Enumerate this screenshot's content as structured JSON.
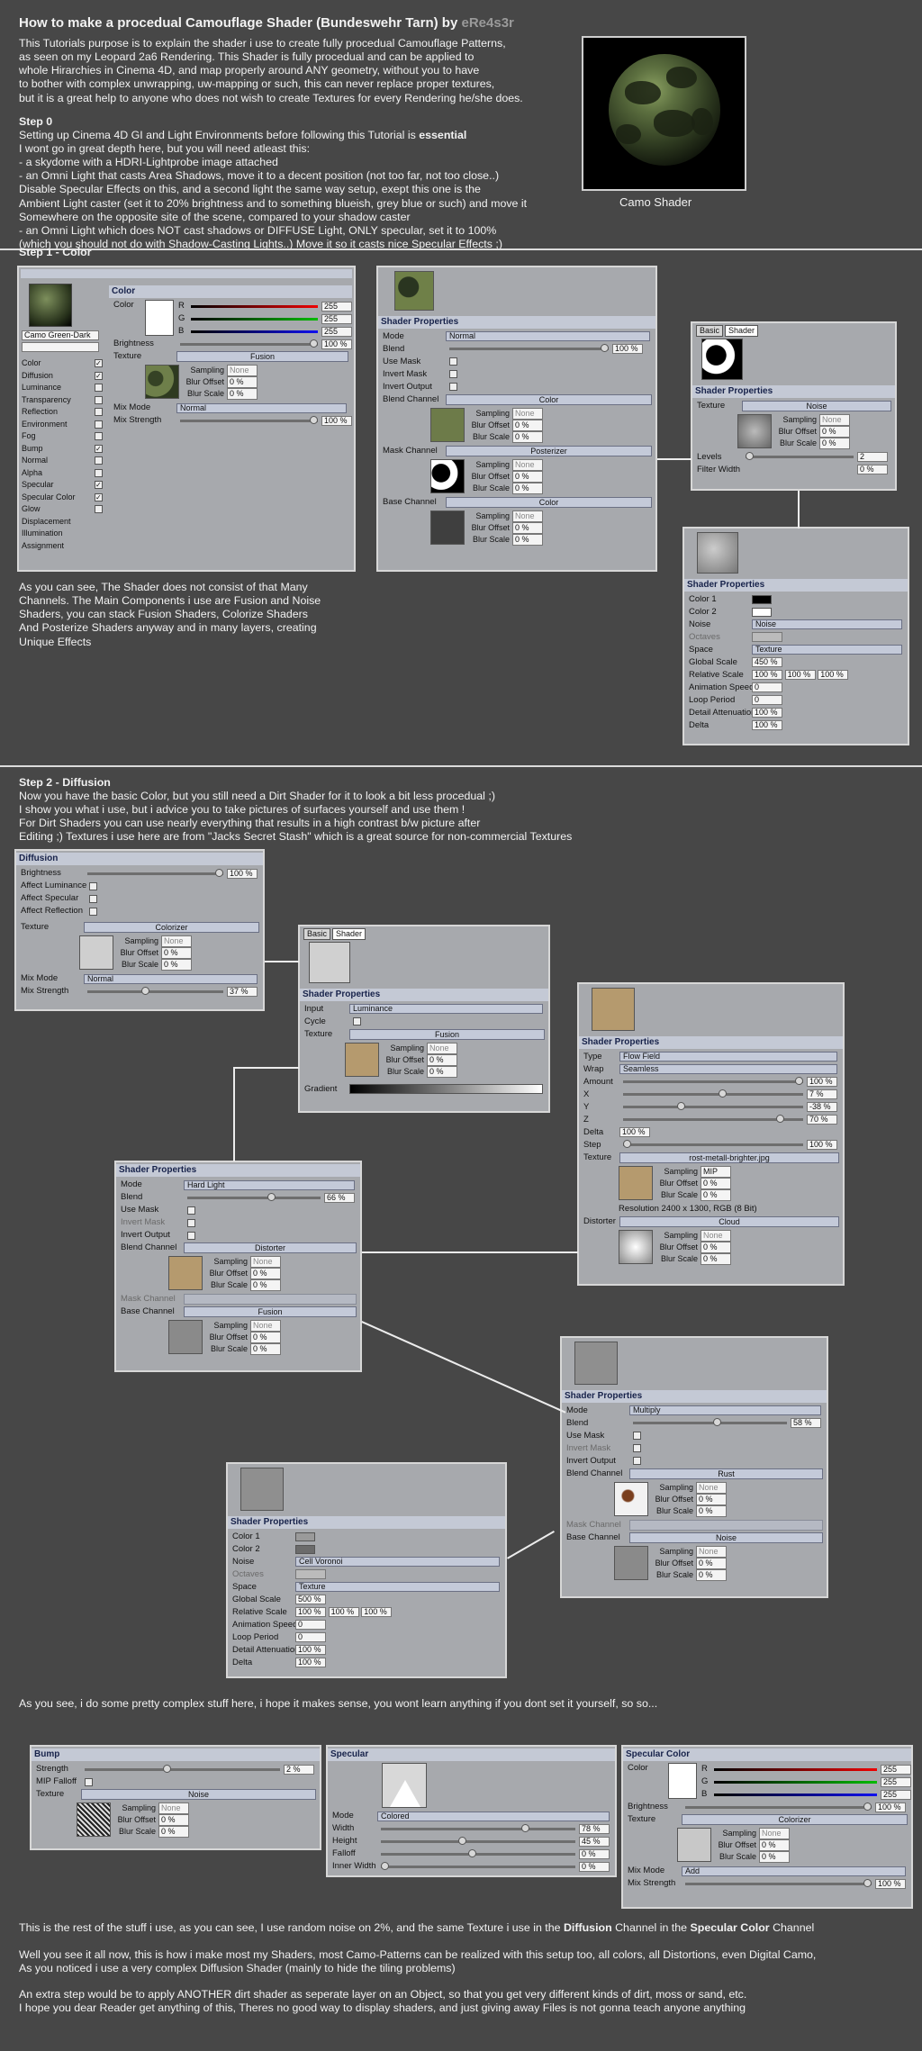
{
  "title": "How to make a procedual Camouflage Shader (Bundeswehr Tarn) by",
  "author": "eRe4s3r",
  "intro": "This Tutorials purpose is to explain the shader i use to create fully procedual Camouflage Patterns,\nas seen on my Leopard 2a6 Rendering. This Shader is fully procedual and can be applied to\nwhole Hirarchies in Cinema 4D, and map properly around ANY geometry, without you to have\nto bother with complex unwrapping, uw-mapping or such, this can never replace proper textures,\nbut it is a great help to anyone who does not wish to create Textures for every Rendering he/she does.",
  "preview_caption": "Camo Shader",
  "step0": {
    "heading": "Step 0",
    "line1": "Setting up Cinema 4D GI and Light Environments before following this Tutorial is",
    "line1_bold": "essential",
    "body": "I wont go in great depth here, but you will need atleast this:\n- a skydome with a HDRI-Lightprobe image attached\n- an Omni Light that casts Area Shadows, move it to a decent position (not too far, not too close..)\n  Disable Specular Effects on this, and a second light the same way setup, exept this one is the\n  Ambient Light caster (set it to 20% brightness and to something blueish, grey blue or such) and move it\n  Somewhere on the opposite site of the scene, compared to your shadow caster\n- an Omni Light which does NOT cast shadows or DIFFUSE Light, ONLY specular, set it to 100%\n  (which you should not do with Shadow-Casting Lights..) Move it so it casts nice Specular Effects ;)"
  },
  "step1": {
    "heading": "Step 1 - Color",
    "body": "As you can see, The Shader does not consist of that Many\nChannels. The Main Components i use are Fusion and Noise\nShaders, you can stack Fusion Shaders, Colorize Shaders\nAnd Posterize Shaders anyway and in many layers, creating\nUnique Effects"
  },
  "step2": {
    "heading": "Step 2 - Diffusion",
    "body": "Now you have the basic Color, but you still need a Dirt Shader for it to look a bit less procedual ;)\nI show you what i use, but i advice you to take pictures of surfaces yourself and use them !\nFor Dirt Shaders you can use nearly everything that results in a high contrast b/w picture after\nEditing ;) Textures i use here are from \"Jacks Secret Stash\" which is a great source for non-commercial Textures",
    "after": "As you see, i do some pretty complex stuff here, i hope it makes sense, you wont learn anything if you dont set it yourself, so so..."
  },
  "closing": {
    "line1_pre": "This is the rest of the stuff i use, as you can see, I use random noise on 2%, and the same Texture i use in the",
    "line1_b1": "Diffusion",
    "line1_mid": "Channel in the",
    "line1_b2": "Specular Color",
    "line1_post": "Channel",
    "para2": "Well you see it all now, this is how i make most my Shaders, most Camo-Patterns can be realized with this setup too, all colors, all Distortions, even Digital Camo,\nAs you noticed i use a very complex Diffusion Shader (mainly to hide the tiling problems)",
    "para3": "An extra step would be to apply ANOTHER dirt shader as seperate layer on an Object, so that you get very different kinds of dirt, moss or sand, etc.\nI hope you dear Reader get anything of this, Theres no good way to display shaders, and just giving away Files is not gonna teach anyone anything"
  },
  "colorPanel": {
    "material": "Camo Green-Dark",
    "section": "Color",
    "color_label": "Color",
    "r": "255",
    "g": "255",
    "b": "255",
    "brightness": "Brightness",
    "brightness_val": "100 %",
    "texture": "Texture",
    "texture_btn": "Fusion",
    "sampling": "Sampling",
    "none": "None",
    "blur_offset": "Blur Offset",
    "blur_scale": "Blur Scale",
    "zero": "0 %",
    "mixmode": "Mix Mode",
    "normal": "Normal",
    "mixstrength": "Mix Strength",
    "mix_val": "100 %",
    "channels": [
      "Color",
      "Diffusion",
      "Luminance",
      "Transparency",
      "Reflection",
      "Environment",
      "Fog",
      "Bump",
      "Normal",
      "Alpha",
      "Specular",
      "Specular Color",
      "Glow",
      "Displacement",
      "Illumination",
      "Assignment"
    ]
  },
  "fusion1": {
    "title": "Shader Properties",
    "mode": "Mode",
    "mode_val": "Normal",
    "blend": "Blend",
    "blend_val": "100 %",
    "usemask": "Use Mask",
    "invmask": "Invert Mask",
    "invout": "Invert Output",
    "blendch": "Blend Channel",
    "blendbtn": "Color",
    "maskch": "Mask Channel",
    "maskbtn": "Posterizer",
    "basech": "Base Channel",
    "basebtn": "Color"
  },
  "posterizer": {
    "tab1": "Basic",
    "tab2": "Shader",
    "title": "Shader Properties",
    "texture": "Texture",
    "tex_btn": "Noise",
    "levels": "Levels",
    "levels_val": "2",
    "filter": "Filter Width",
    "filter_val": "0 %"
  },
  "noise1": {
    "title": "Shader Properties",
    "color1": "Color 1",
    "color2": "Color 2",
    "noise": "Noise",
    "noise_val": "Noise",
    "octaves": "Octaves",
    "space": "Space",
    "space_val": "Texture",
    "gscale": "Global Scale",
    "gscale_val": "450 %",
    "rscale": "Relative Scale",
    "r1": "100 %",
    "r2": "100 %",
    "r3": "100 %",
    "anim": "Animation Speed",
    "anim_val": "0",
    "loop": "Loop Period",
    "loop_val": "0",
    "detail": "Detail Attenuation",
    "detail_val": "100 %",
    "delta": "Delta",
    "delta_val": "100 %"
  },
  "diffPanel": {
    "section": "Diffusion",
    "brightness": "Brightness",
    "b_val": "100 %",
    "affLum": "Affect Luminance",
    "affSpec": "Affect Specular",
    "affRefl": "Affect Reflection",
    "texture": "Texture",
    "tex_btn": "Colorizer",
    "mixmode": "Mix Mode",
    "mix_val": "Normal",
    "mixstrength": "Mix Strength",
    "ms_val": "37 %"
  },
  "colorizer": {
    "tab1": "Basic",
    "tab2": "Shader",
    "title": "Shader Properties",
    "input": "Input",
    "input_val": "Luminance",
    "cycle": "Cycle",
    "texture": "Texture",
    "tex_btn": "Fusion",
    "gradient": "Gradient"
  },
  "distorter": {
    "title": "Shader Properties",
    "type": "Type",
    "type_val": "Flow Field",
    "wrap": "Wrap",
    "wrap_val": "Seamless",
    "amount": "Amount",
    "amount_val": "100 %",
    "x": "X",
    "x_val": "7 %",
    "y": "Y",
    "y_val": "-38 %",
    "z": "Z",
    "z_val": "70 %",
    "delta": "Delta",
    "delta_val": "100 %",
    "step": "Step",
    "step_val": "100 %",
    "texture": "Texture",
    "tex_file": "rost-metall-brighter.jpg",
    "sampling_val": "MIP",
    "resolution": "Resolution 2400 x 1300, RGB (8 Bit)",
    "distorter": "Distorter",
    "dist_btn": "Cloud"
  },
  "fusion2": {
    "title": "Shader Properties",
    "mode": "Mode",
    "mode_val": "Hard Light",
    "blend": "Blend",
    "blend_val": "66 %",
    "usemask": "Use Mask",
    "invmask": "Invert Mask",
    "invout": "Invert Output",
    "blendch": "Blend Channel",
    "blendbtn": "Distorter",
    "maskch": "Mask Channel",
    "basech": "Base Channel",
    "basebtn": "Fusion"
  },
  "fusion3": {
    "title": "Shader Properties",
    "mode": "Mode",
    "mode_val": "Multiply",
    "blend": "Blend",
    "blend_val": "58 %",
    "usemask": "Use Mask",
    "invmask": "Invert Mask",
    "invout": "Invert Output",
    "blendch": "Blend Channel",
    "blendbtn": "Rust",
    "maskch": "Mask Channel",
    "basech": "Base Channel",
    "basebtn": "Noise"
  },
  "noise2": {
    "title": "Shader Properties",
    "color1": "Color 1",
    "color2": "Color 2",
    "noise": "Noise",
    "noise_val": "Cell Voronoi",
    "octaves": "Octaves",
    "space": "Space",
    "space_val": "Texture",
    "gscale": "Global Scale",
    "gscale_val": "500 %",
    "rscale": "Relative Scale",
    "r1": "100 %",
    "r2": "100 %",
    "r3": "100 %",
    "anim": "Animation Speed",
    "anim_val": "0",
    "loop": "Loop Period",
    "loop_val": "0",
    "detail": "Detail Attenuation",
    "detail_val": "100 %",
    "delta": "Delta",
    "delta_val": "100 %"
  },
  "bump": {
    "section": "Bump",
    "strength": "Strength",
    "s_val": "2 %",
    "mip": "MIP Falloff",
    "texture": "Texture",
    "tex_btn": "Noise"
  },
  "specular": {
    "section": "Specular",
    "mode": "Mode",
    "mode_val": "Colored",
    "width": "Width",
    "w_val": "78 %",
    "height": "Height",
    "h_val": "45 %",
    "falloff": "Falloff",
    "f_val": "0 %",
    "inner": "Inner Width",
    "i_val": "0 %"
  },
  "speccolor": {
    "section": "Specular Color",
    "color": "Color",
    "r": "255",
    "g": "255",
    "b": "255",
    "brightness": "Brightness",
    "b_val": "100 %",
    "texture": "Texture",
    "tex_btn": "Colorizer",
    "mixmode": "Mix Mode",
    "mix_val": "Add",
    "mixstrength": "Mix Strength",
    "ms_val": "100 %"
  }
}
